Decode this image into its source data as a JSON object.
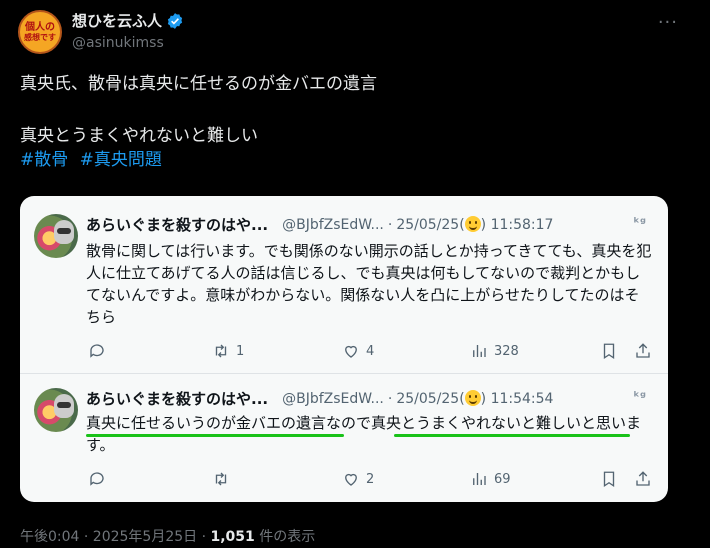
{
  "post": {
    "avatar_text_1": "個人の",
    "avatar_text_2": "感想です",
    "display_name": "想ひを云ふ人",
    "handle": "@asinukimss",
    "more_label": "···",
    "text_line1": "真央氏、散骨は真央に任せるのが金バエの遺言",
    "text_line2": "真央とうまくやれないと難しい",
    "hashtags": [
      "#散骨",
      "#真央問題"
    ]
  },
  "quoted": [
    {
      "name": "あらいぐまを殺すのはや...",
      "handle": "@BJbfZsEdW...",
      "sep": "·",
      "date_prefix": "25/05/25(",
      "date_suffix": ") 11:58:17",
      "x_icon": "ᵏᵍ",
      "body": "散骨に関しては行います。でも関係のない開示の話しとか持ってきてても、真央を犯人に仕立てあげてる人の話は信じるし、でも真央は何もしてないので裁判とかもしてないんですよ。意味がわからない。関係ない人を凸に上がらせたりしてたのはそちら",
      "replies": "",
      "retweets": "1",
      "likes": "4",
      "views": "328"
    },
    {
      "name": "あらいぐまを殺すのはや...",
      "handle": "@BJbfZsEdW...",
      "sep": "·",
      "date_prefix": "25/05/25(",
      "date_suffix": ") 11:54:54",
      "x_icon": "ᵏᵍ",
      "body": "真央に任せるいうのが金バエの遺言なので真央とうまくやれないと難しいと思います。",
      "replies": "",
      "retweets": "",
      "likes": "2",
      "views": "69"
    }
  ],
  "footer": {
    "time": "午後0:04 · 2025年5月25日 · ",
    "views_count": "1,051",
    "views_label": " 件の表示"
  },
  "colors": {
    "background": "#000000",
    "card": "#f7f9f9",
    "hashtag": "#1d9bf0",
    "underline": "#19c219",
    "verified": "#1d9bf0"
  }
}
